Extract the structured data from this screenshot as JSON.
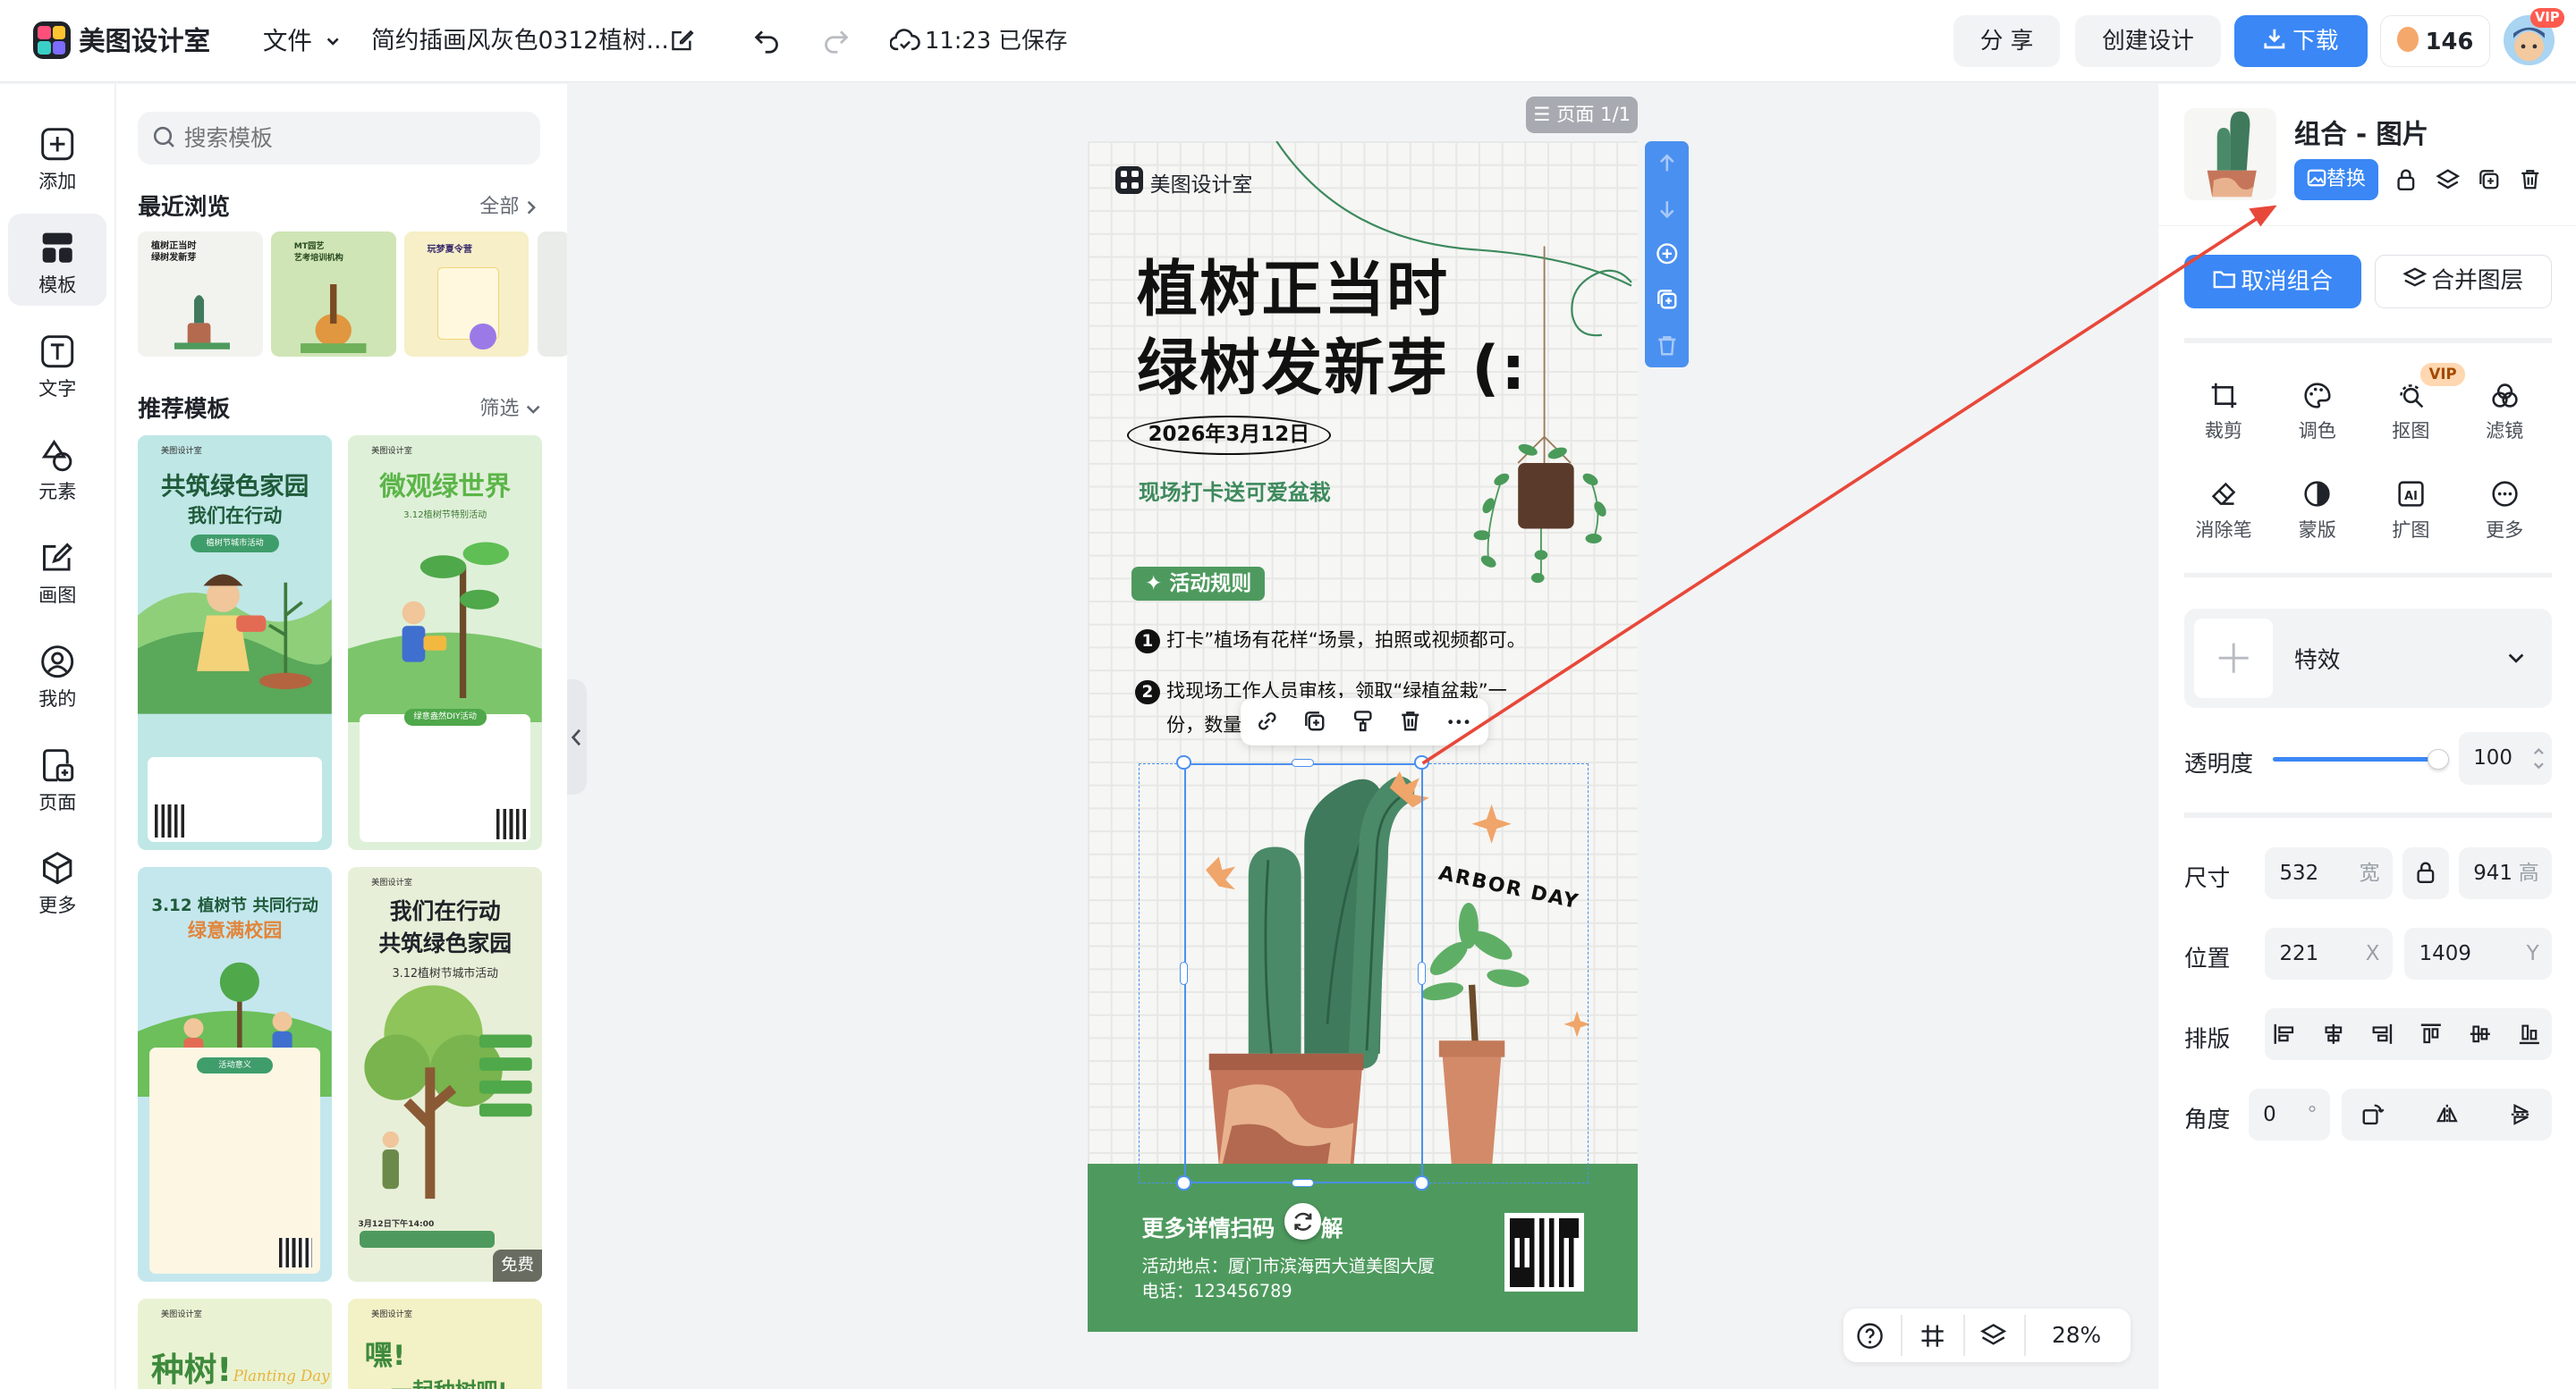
{
  "app": {
    "name": "美图设计室",
    "file_menu": "文件",
    "doc_title": "简约插画风灰色0312植树...",
    "save_time": "11:23 已保存"
  },
  "toolbar": {
    "share": "分 享",
    "create": "创建设计",
    "download": "下载",
    "coins": "146",
    "vip": "VIP"
  },
  "rail": [
    {
      "label": "添加",
      "icon": "plus-square-icon"
    },
    {
      "label": "模板",
      "icon": "template-grid-icon"
    },
    {
      "label": "文字",
      "icon": "text-icon"
    },
    {
      "label": "元素",
      "icon": "shapes-icon"
    },
    {
      "label": "画图",
      "icon": "draw-icon"
    },
    {
      "label": "我的",
      "icon": "user-icon"
    },
    {
      "label": "页面",
      "icon": "page-add-icon"
    },
    {
      "label": "更多",
      "icon": "cube-icon"
    }
  ],
  "templates": {
    "search_placeholder": "搜索模板",
    "recent_title": "最近浏览",
    "recent_link": "全部",
    "recommend_title": "推荐模板",
    "recommend_link": "筛选",
    "recent": [
      {
        "title": "植树正当时\n绿树发新芽"
      },
      {
        "title": "MT园艺\n艺考培训机构"
      },
      {
        "title": "玩梦夏令营"
      }
    ],
    "cards": [
      {
        "brand": "美图设计室",
        "title1": "共筑绿色家园",
        "title2": "我们在行动",
        "tag": "植树节城市活动"
      },
      {
        "brand": "美图设计室",
        "title1": "微观绿世界",
        "title2": "3.12植树节特别活动",
        "tag": "绿意盎然DIY活动"
      },
      {
        "brand": "美图设计室",
        "title1": "3.12 植树节 共同行动",
        "title2": "绿意满校园",
        "tag": "活动意义"
      },
      {
        "brand": "美图设计室",
        "title1": "我们在行动",
        "title2": "共筑绿色家园",
        "tag": "3.12植树节城市活动",
        "badge": "免费",
        "time": "3月12日下午14:00"
      },
      {
        "brand": "美图设计室",
        "title1": "种树!",
        "title2": "Planting Day"
      },
      {
        "brand": "美图设计室",
        "title1": "嘿!",
        "title2": "一起种树吧!"
      }
    ]
  },
  "canvas": {
    "page_label": "页面 1/1",
    "zoom": "28%"
  },
  "poster": {
    "brand": "美图设计室",
    "title1": "植树正当时",
    "title2": "绿树发新芽 (:",
    "date": "2026年3月12日",
    "subtitle": "现场打卡送可爱盆栽",
    "rules_tag": "活动规则",
    "rule1": "打卡”植场有花样“场景，拍照或视频都可。",
    "rule2": "找现场工作人员审核，领取“绿植盆栽”一",
    "rule2b": "份，数量",
    "arbor": "ARBOR DAY",
    "footer_title": "更多详情扫码",
    "footer_title_end": "解",
    "address": "活动地点：厦门市滨海西大道美图大厦",
    "phone": "电话：123456789"
  },
  "props": {
    "title": "组合 - 图片",
    "replace": "替换",
    "ungroup": "取消组合",
    "merge": "合并图层",
    "tools": [
      {
        "label": "裁剪"
      },
      {
        "label": "调色"
      },
      {
        "label": "抠图",
        "vip": "VIP"
      },
      {
        "label": "滤镜"
      },
      {
        "label": "消除笔"
      },
      {
        "label": "蒙版"
      },
      {
        "label": "扩图"
      },
      {
        "label": "更多"
      }
    ],
    "effect": "特效",
    "opacity_label": "透明度",
    "opacity": "100",
    "opacity_fraction": 1.0,
    "size_label": "尺寸",
    "width": "532",
    "width_unit": "宽",
    "height": "941",
    "height_unit": "高",
    "pos_label": "位置",
    "x": "221",
    "x_unit": "X",
    "y": "1409",
    "y_unit": "Y",
    "arrange_label": "排版",
    "angle_label": "角度",
    "angle": "0",
    "angle_unit": "°"
  },
  "colors": {
    "accent": "#3a87f5",
    "poster_green": "#4e9a5e",
    "arrow": "#e8483a"
  }
}
